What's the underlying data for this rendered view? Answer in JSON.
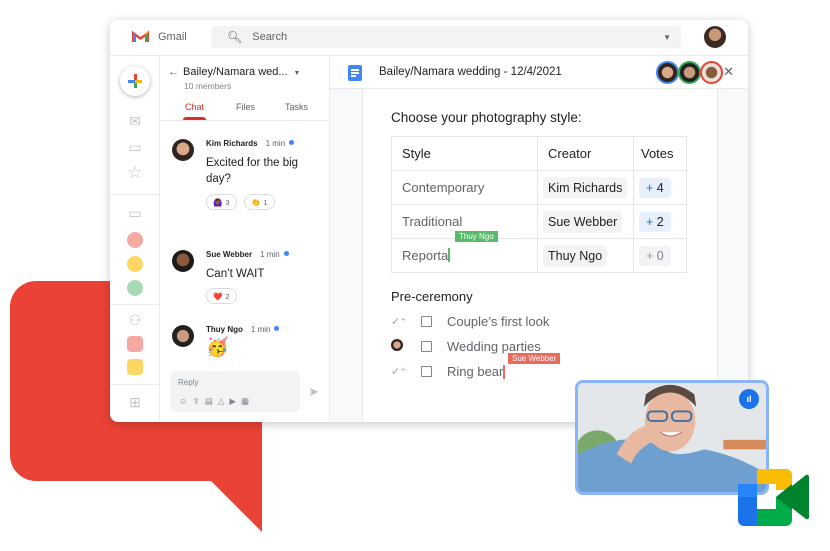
{
  "app": {
    "name": "Gmail",
    "search_placeholder": "Search"
  },
  "colors": {
    "brand_red": "#ea4335",
    "accent_blue": "#1a73e8",
    "chat_tab": "#d93025"
  },
  "sidebar": {
    "icons": [
      "compose-icon",
      "mail-icon",
      "inbox-icon",
      "star-icon",
      "chat-icon",
      "space-red",
      "space-yellow",
      "space-green",
      "people-icon",
      "room-red",
      "room-yellow",
      "video-add-icon"
    ]
  },
  "chat": {
    "title": "Bailey/Namara wed...",
    "members": "10 members",
    "tabs": [
      {
        "label": "Chat",
        "active": true
      },
      {
        "label": "Files"
      },
      {
        "label": "Tasks"
      }
    ],
    "messages": [
      {
        "author": "Kim Richards",
        "time": "1 min",
        "text": "Excited for the big day?",
        "reactions": [
          {
            "emoji": "🙆🏾‍♀️",
            "count": "3"
          },
          {
            "emoji": "👏",
            "count": "1"
          }
        ]
      },
      {
        "author": "Sue Webber",
        "time": "1 min",
        "text": "Can’t WAIT",
        "reactions": [
          {
            "emoji": "❤️",
            "count": "2"
          }
        ]
      },
      {
        "author": "Thuy Ngo",
        "time": "1 min",
        "text": "🥳",
        "reactions": []
      }
    ],
    "reply_placeholder": "Reply"
  },
  "doc": {
    "title": "Bailey/Namara wedding - 12/4/2021",
    "heading": "Choose your photography style:",
    "table": {
      "headers": [
        "Style",
        "Creator",
        "Votes"
      ],
      "rows": [
        {
          "style": "Contemporary",
          "creator": "Kim Richards",
          "votes": "4"
        },
        {
          "style": "Traditional",
          "creator": "Sue Webber",
          "votes": "2"
        },
        {
          "style": "Reporta",
          "creator": "Thuy Ngo",
          "votes": "0"
        }
      ],
      "vote_prefix": "+"
    },
    "cursor_thuy": "Thuy Ngo",
    "section": "Pre-ceremony",
    "tasks": [
      "Couple’s first look",
      "Wedding parties",
      "Ring bear"
    ],
    "cursor_sue": "Sue Webber"
  }
}
